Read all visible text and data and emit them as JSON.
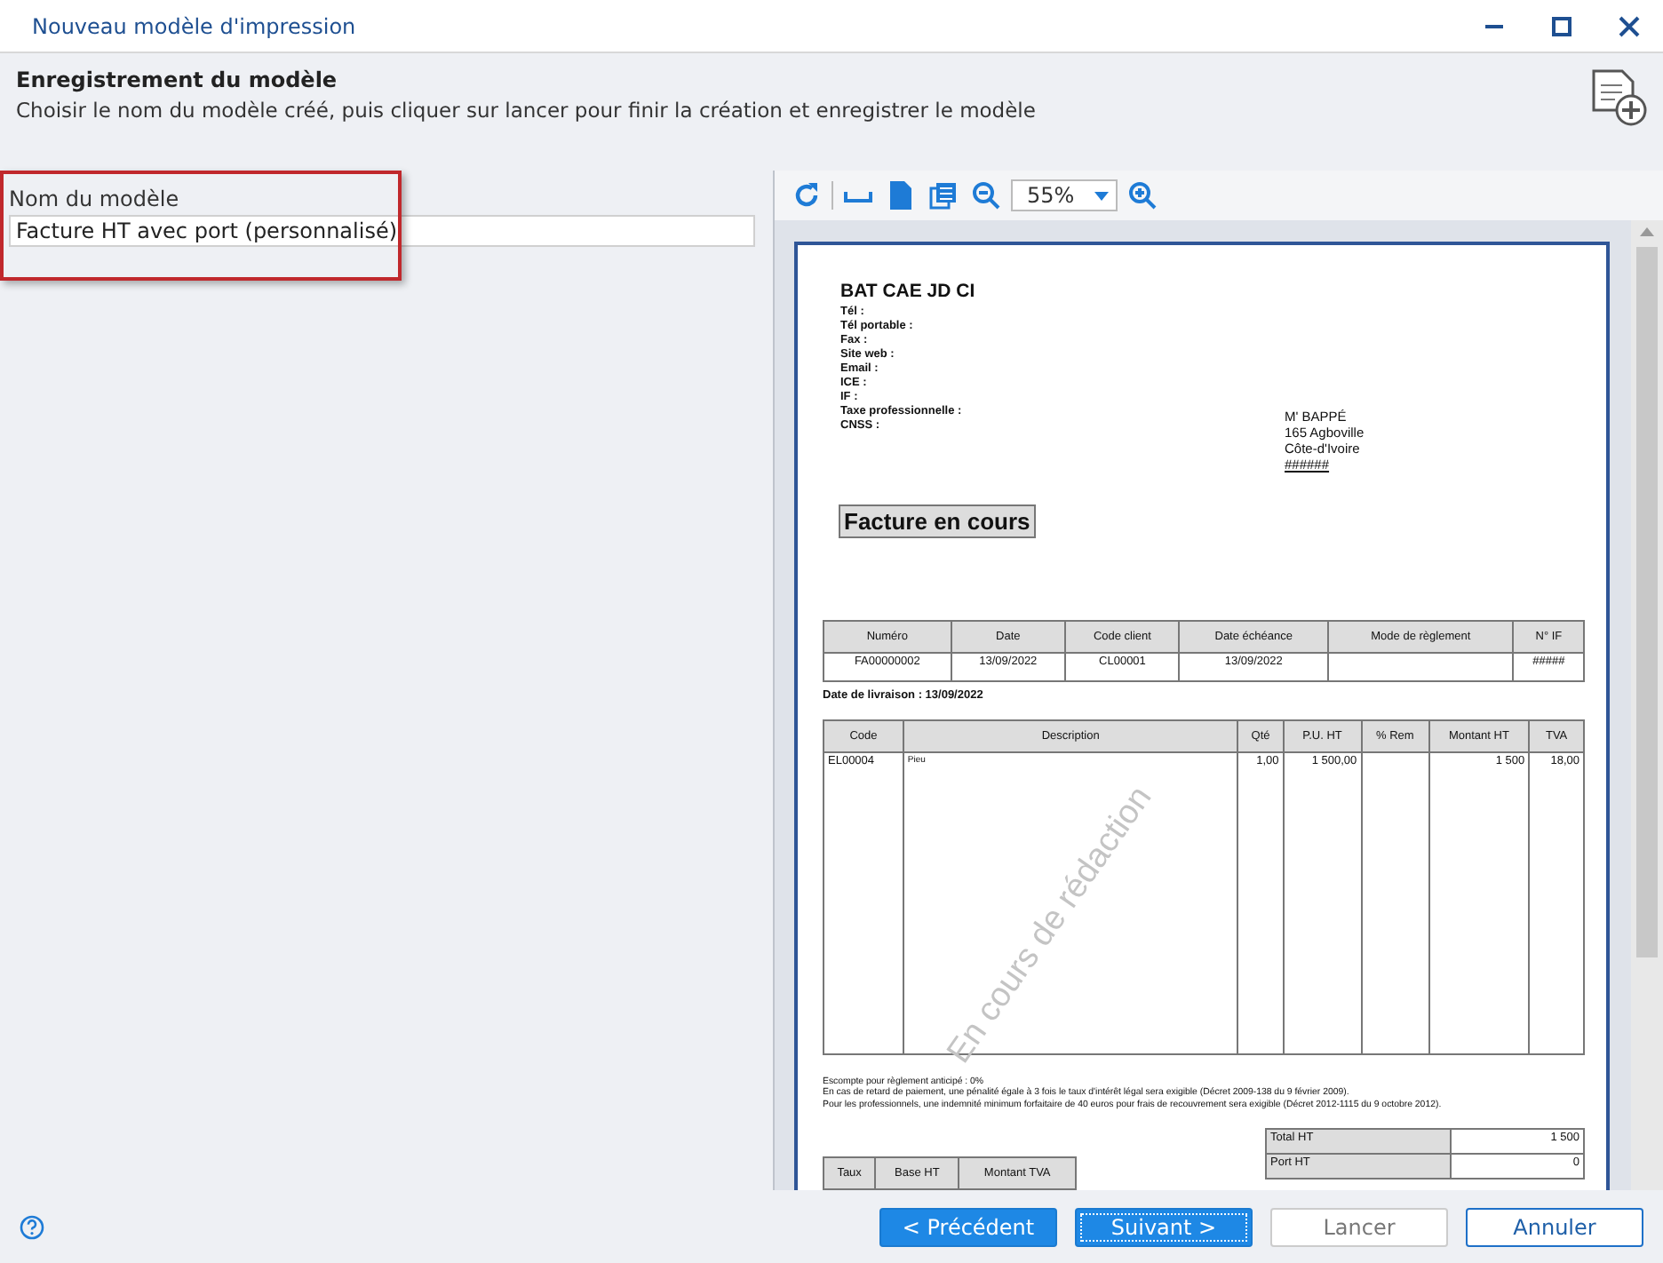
{
  "window": {
    "title": "Nouveau modèle d'impression"
  },
  "header": {
    "title": "Enregistrement du modèle",
    "subtitle": "Choisir le nom du modèle créé, puis cliquer sur lancer pour finir la création et enregistrer le modèle"
  },
  "form": {
    "label": "Nom du modèle",
    "value": "Facture HT avec port (personnalisé)"
  },
  "toolbar": {
    "zoom": "55%"
  },
  "document": {
    "company": "BAT CAE JD CI",
    "fields": [
      "Tél :",
      "Tél portable :",
      "Fax :",
      "Site web :",
      "Email :",
      "ICE :",
      "IF :",
      "Taxe professionnelle :",
      "CNSS :"
    ],
    "recipient": [
      "M' BAPPÉ",
      "165 Agboville",
      "Côte-d'Ivoire",
      "######"
    ],
    "title": "Facture en cours",
    "info_table": {
      "columns": [
        {
          "label": "Numéro",
          "value": "FA00000002"
        },
        {
          "label": "Date",
          "value": "13/09/2022"
        },
        {
          "label": "Code client",
          "value": "CL00001"
        },
        {
          "label": "Date échéance",
          "value": "13/09/2022"
        },
        {
          "label": "Mode de règlement"
        },
        {
          "label": "N° IF",
          "value": "#####"
        }
      ]
    },
    "delivery": "Date de livraison : 13/09/2022",
    "lines_table": {
      "columns": [
        "Code",
        "Description",
        "Qté",
        "P.U. HT",
        "% Rem",
        "Montant HT",
        "TVA"
      ],
      "rows": [
        [
          "EL00004",
          "Pieu",
          "1,00",
          "1 500,00",
          "",
          "1 500",
          "18,00"
        ]
      ]
    },
    "stamp": "En cours de rédaction",
    "notes": [
      "Escompte pour règlement anticipé : 0%",
      "En cas de retard de paiement, une pénalité égale à 3 fois le taux d'intérêt légal sera exigible (Décret 2009-138 du 9 février 2009).",
      "Pour les professionnels, une indemnité minimum forfaitaire de 40 euros pour frais de recouvrement sera exigible (Décret 2012-1115 du 9 octobre 2012)."
    ],
    "tax_table": {
      "columns": [
        "Taux",
        "Base HT",
        "Montant TVA"
      ]
    },
    "totals": [
      {
        "label": "Total HT",
        "value": "1 500"
      },
      {
        "label": "Port HT",
        "value": "0"
      }
    ]
  },
  "buttons": [
    {
      "label": "< Précédent",
      "kind": "primary",
      "disabled": false,
      "focused": false
    },
    {
      "label": "Suivant >",
      "kind": "primary",
      "disabled": false,
      "focused": true
    },
    {
      "label": "Lancer",
      "kind": "secondary",
      "disabled": true,
      "focused": false
    },
    {
      "label": "Annuler",
      "kind": "secondary",
      "disabled": false,
      "focused": false
    }
  ]
}
